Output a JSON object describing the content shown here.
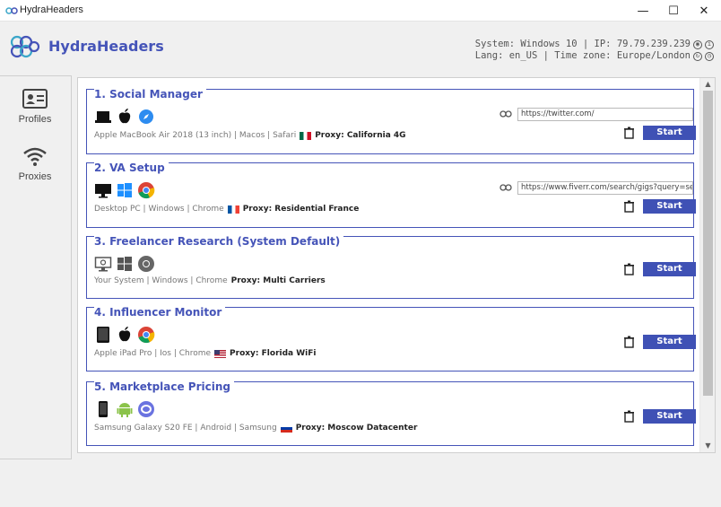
{
  "window": {
    "title": "HydraHeaders",
    "minimize": "—",
    "maximize": "☐",
    "close": "✕"
  },
  "header": {
    "brand": "HydraHeaders",
    "system_line": "System: Windows 10 | IP: 79.79.239.239",
    "lang_line": "Lang: en_US | Time zone: Europe/London"
  },
  "sidebar": {
    "items": [
      {
        "label": "Profiles",
        "icon": "id-card-icon"
      },
      {
        "label": "Proxies",
        "icon": "wifi-icon"
      }
    ]
  },
  "profiles": [
    {
      "title": "1. Social Manager",
      "icons": [
        "laptop-icon",
        "apple-icon",
        "safari-icon"
      ],
      "description": "Apple MacBook Air 2018 (13 inch) | Macos | Safari",
      "flag": "mexico",
      "proxy": "Proxy: California 4G",
      "url": "https://twitter.com/",
      "start_label": "Start"
    },
    {
      "title": "2. VA Setup",
      "icons": [
        "desktop-icon",
        "windows-icon",
        "chrome-icon"
      ],
      "description": "Desktop PC | Windows | Chrome",
      "flag": "france",
      "proxy": "Proxy: Residential France",
      "url": "https://www.fiverr.com/search/gigs?query=seo",
      "start_label": "Start"
    },
    {
      "title": "3. Freelancer Research (System Default)",
      "icons": [
        "system-monitor-icon",
        "windows-icon",
        "chrome-icon"
      ],
      "description": "Your System | Windows | Chrome",
      "flag": "",
      "proxy": "Proxy: Multi Carriers",
      "url": "",
      "start_label": "Start"
    },
    {
      "title": "4. Influencer Monitor",
      "icons": [
        "tablet-icon",
        "apple-icon",
        "chrome-icon"
      ],
      "description": "Apple iPad Pro | Ios | Chrome",
      "flag": "usa",
      "proxy": "Proxy: Florida WiFi",
      "url": "",
      "start_label": "Start"
    },
    {
      "title": "5. Marketplace Pricing",
      "icons": [
        "phone-icon",
        "android-icon",
        "samsung-browser-icon"
      ],
      "description": "Samsung Galaxy S20 FE | Android | Samsung",
      "flag": "russia",
      "proxy": "Proxy: Moscow Datacenter",
      "url": "",
      "start_label": "Start"
    }
  ],
  "colors": {
    "accent": "#4554b8",
    "button": "#3f51b5"
  }
}
